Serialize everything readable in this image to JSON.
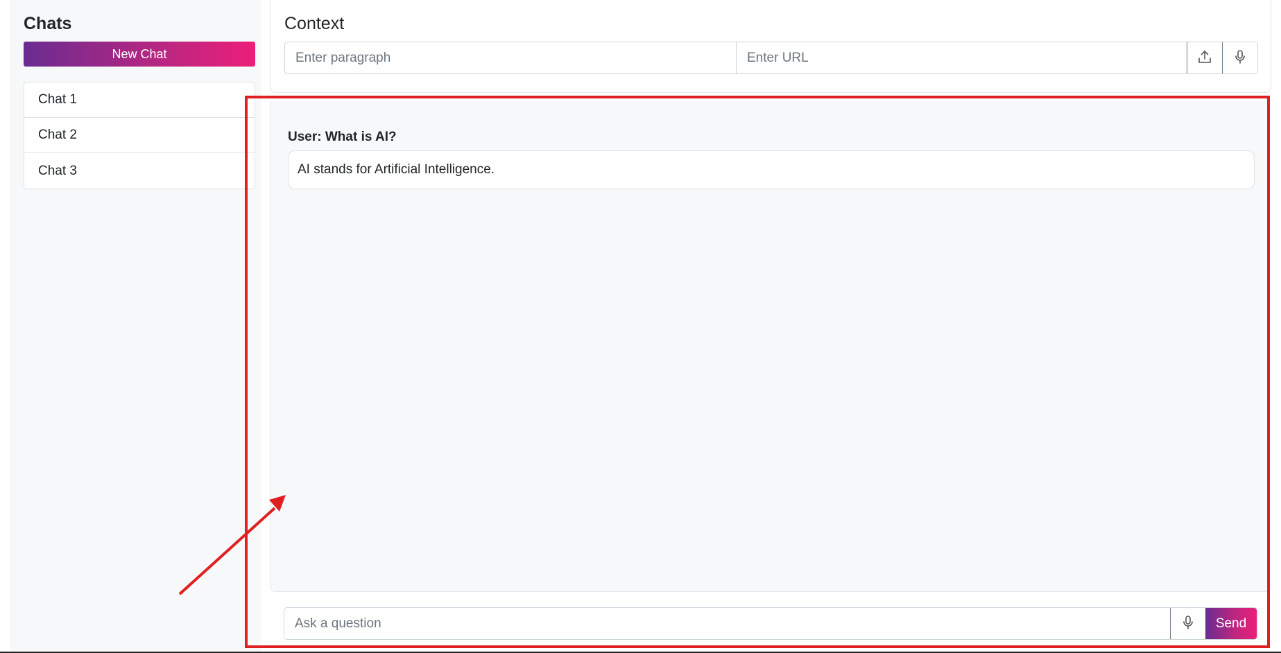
{
  "sidebar": {
    "title": "Chats",
    "new_chat_label": "New Chat",
    "items": [
      {
        "label": "Chat 1"
      },
      {
        "label": "Chat 2"
      },
      {
        "label": "Chat 3"
      }
    ]
  },
  "context": {
    "title": "Context",
    "paragraph_placeholder": "Enter paragraph",
    "url_placeholder": "Enter URL",
    "upload_icon": "upload-icon",
    "mic_icon": "microphone-icon"
  },
  "conversation": {
    "messages": [
      {
        "user": "User: What is AI?",
        "answer": "AI stands for Artificial Intelligence."
      }
    ]
  },
  "composer": {
    "placeholder": "Ask a question",
    "mic_icon": "microphone-icon",
    "send_label": "Send"
  },
  "colors": {
    "brand_gradient_start": "#6a2c91",
    "brand_gradient_end": "#ec1e7a",
    "annotation_red": "#e02020",
    "panel_background": "#f7f8fa"
  }
}
